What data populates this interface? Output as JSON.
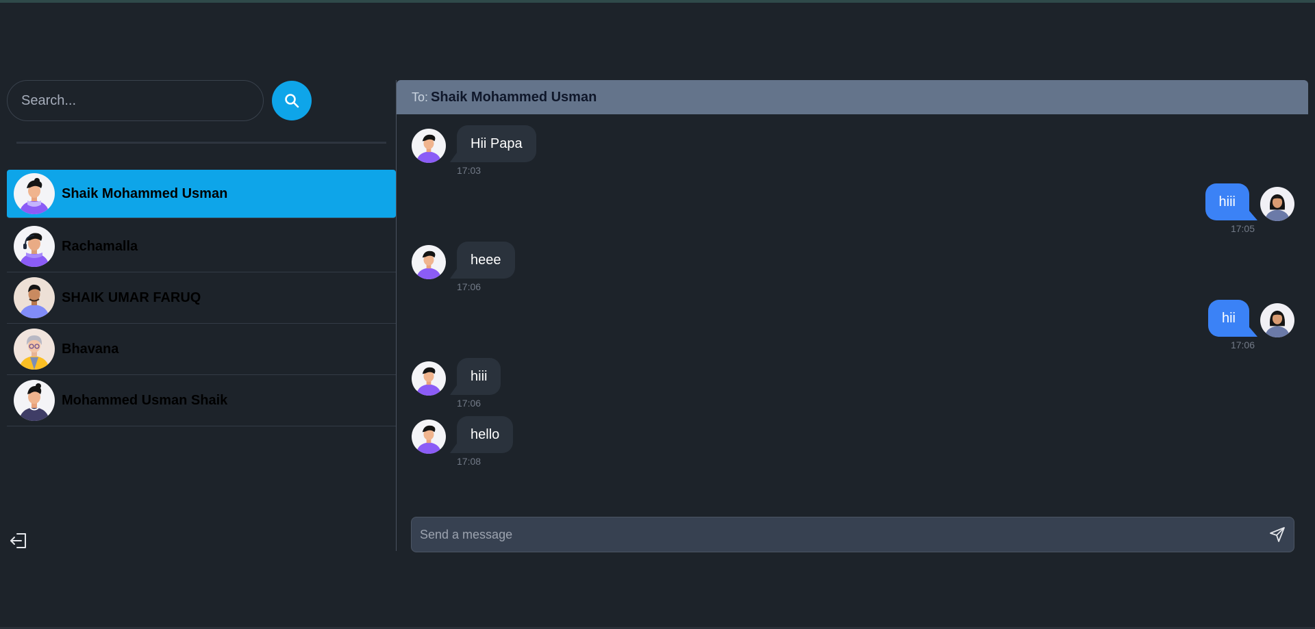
{
  "search": {
    "placeholder": "Search..."
  },
  "conversations": [
    {
      "name": "Shaik Mohammed Usman",
      "active": true,
      "avatar": "boy-purple-avatar"
    },
    {
      "name": "Rachamalla",
      "active": false,
      "avatar": "boy-headphones-avatar"
    },
    {
      "name": "SHAIK UMAR FARUQ",
      "active": false,
      "avatar": "boy-beige-avatar"
    },
    {
      "name": "Bhavana",
      "active": false,
      "avatar": "elder-glasses-avatar"
    },
    {
      "name": "Mohammed Usman Shaik",
      "active": false,
      "avatar": "boy-navy-avatar"
    }
  ],
  "chat": {
    "to_label": "To:",
    "to_name": "Shaik Mohammed Usman",
    "messages": [
      {
        "text": "Hii Papa",
        "time": "17:03",
        "side": "start"
      },
      {
        "text": "hiii",
        "time": "17:05",
        "side": "end"
      },
      {
        "text": "heee",
        "time": "17:06",
        "side": "start"
      },
      {
        "text": "hii",
        "time": "17:06",
        "side": "end"
      },
      {
        "text": "hiii",
        "time": "17:06",
        "side": "start"
      },
      {
        "text": "hello",
        "time": "17:08",
        "side": "start"
      }
    ],
    "composer_placeholder": "Send a message"
  },
  "icons": {
    "search": "search-icon",
    "send": "send-icon",
    "logout": "logout-icon"
  },
  "colors": {
    "background": "#1d232a",
    "accent": "#0ea5e9",
    "outgoing_bubble": "#3b82f6",
    "incoming_bubble": "#2a323c",
    "header": "#64748b"
  }
}
